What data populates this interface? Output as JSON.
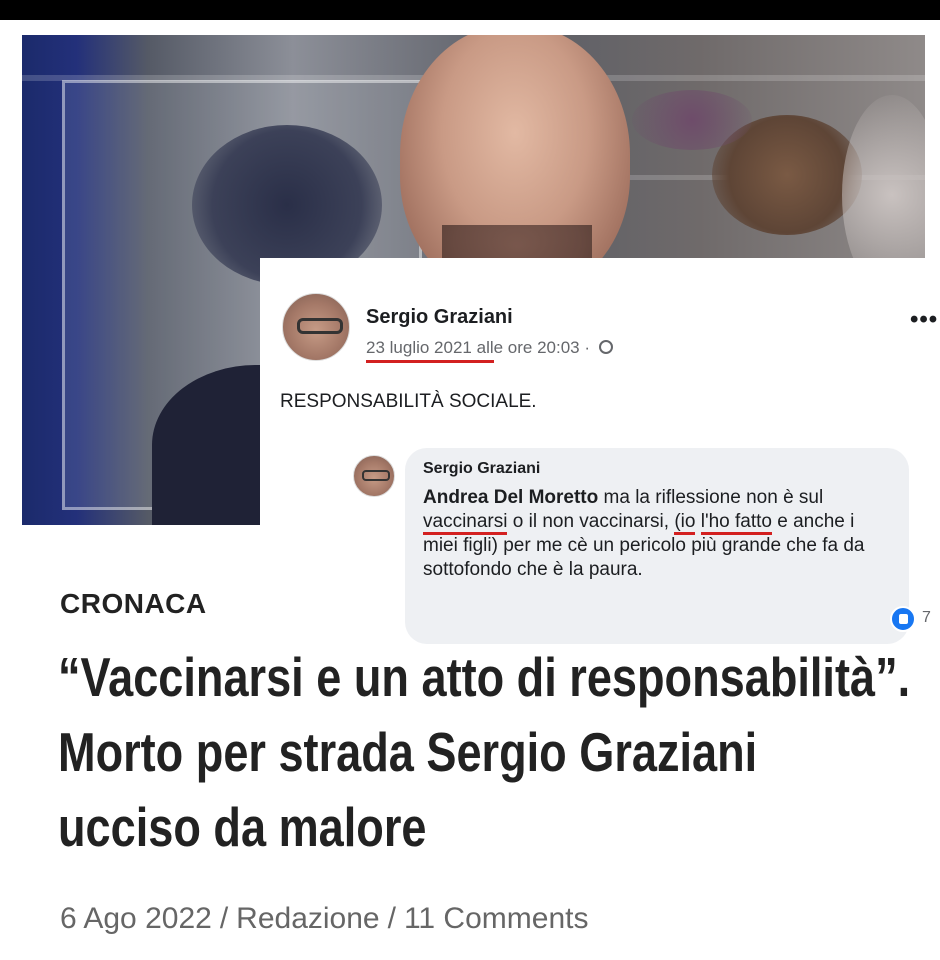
{
  "post": {
    "author": "Sergio Graziani",
    "date": "23 luglio 2021",
    "time_text": "alle ore 20:03 ·",
    "more_label": "•••",
    "status": "RESPONSABILITÀ SOCIALE.",
    "comment": {
      "author": "Sergio Graziani",
      "mention": "Andrea Del Moretto",
      "text_1": " ma la riflessione non è sul ",
      "vaccinarsi": "vaccinarsi",
      "text_2": " o il non vaccinarsi, ",
      "paren_open": "(io",
      "text_3": " ",
      "ho_fatto": "l'ho fatto",
      "text_4": " e anche i miei figli) per me cè un pericolo più grande che fa da sottofondo che è la paura."
    },
    "reaction_count": "7"
  },
  "article": {
    "category": "CRONACA",
    "headline": "“Vaccinarsi e un atto di responsabilità”. Morto per strada Sergio Graziani ucciso da malore",
    "date": "6 Ago 2022",
    "author": "Redazione",
    "comments": "11 Comments",
    "separator": "/"
  },
  "icons": {
    "globe": "globe-icon",
    "like_reaction": "like-reaction-icon",
    "more": "more-options-icon"
  },
  "colors": {
    "underline": "#d32020",
    "facebook_blue": "#1877f2",
    "text_dark": "#222222",
    "byline_gray": "#666666"
  }
}
